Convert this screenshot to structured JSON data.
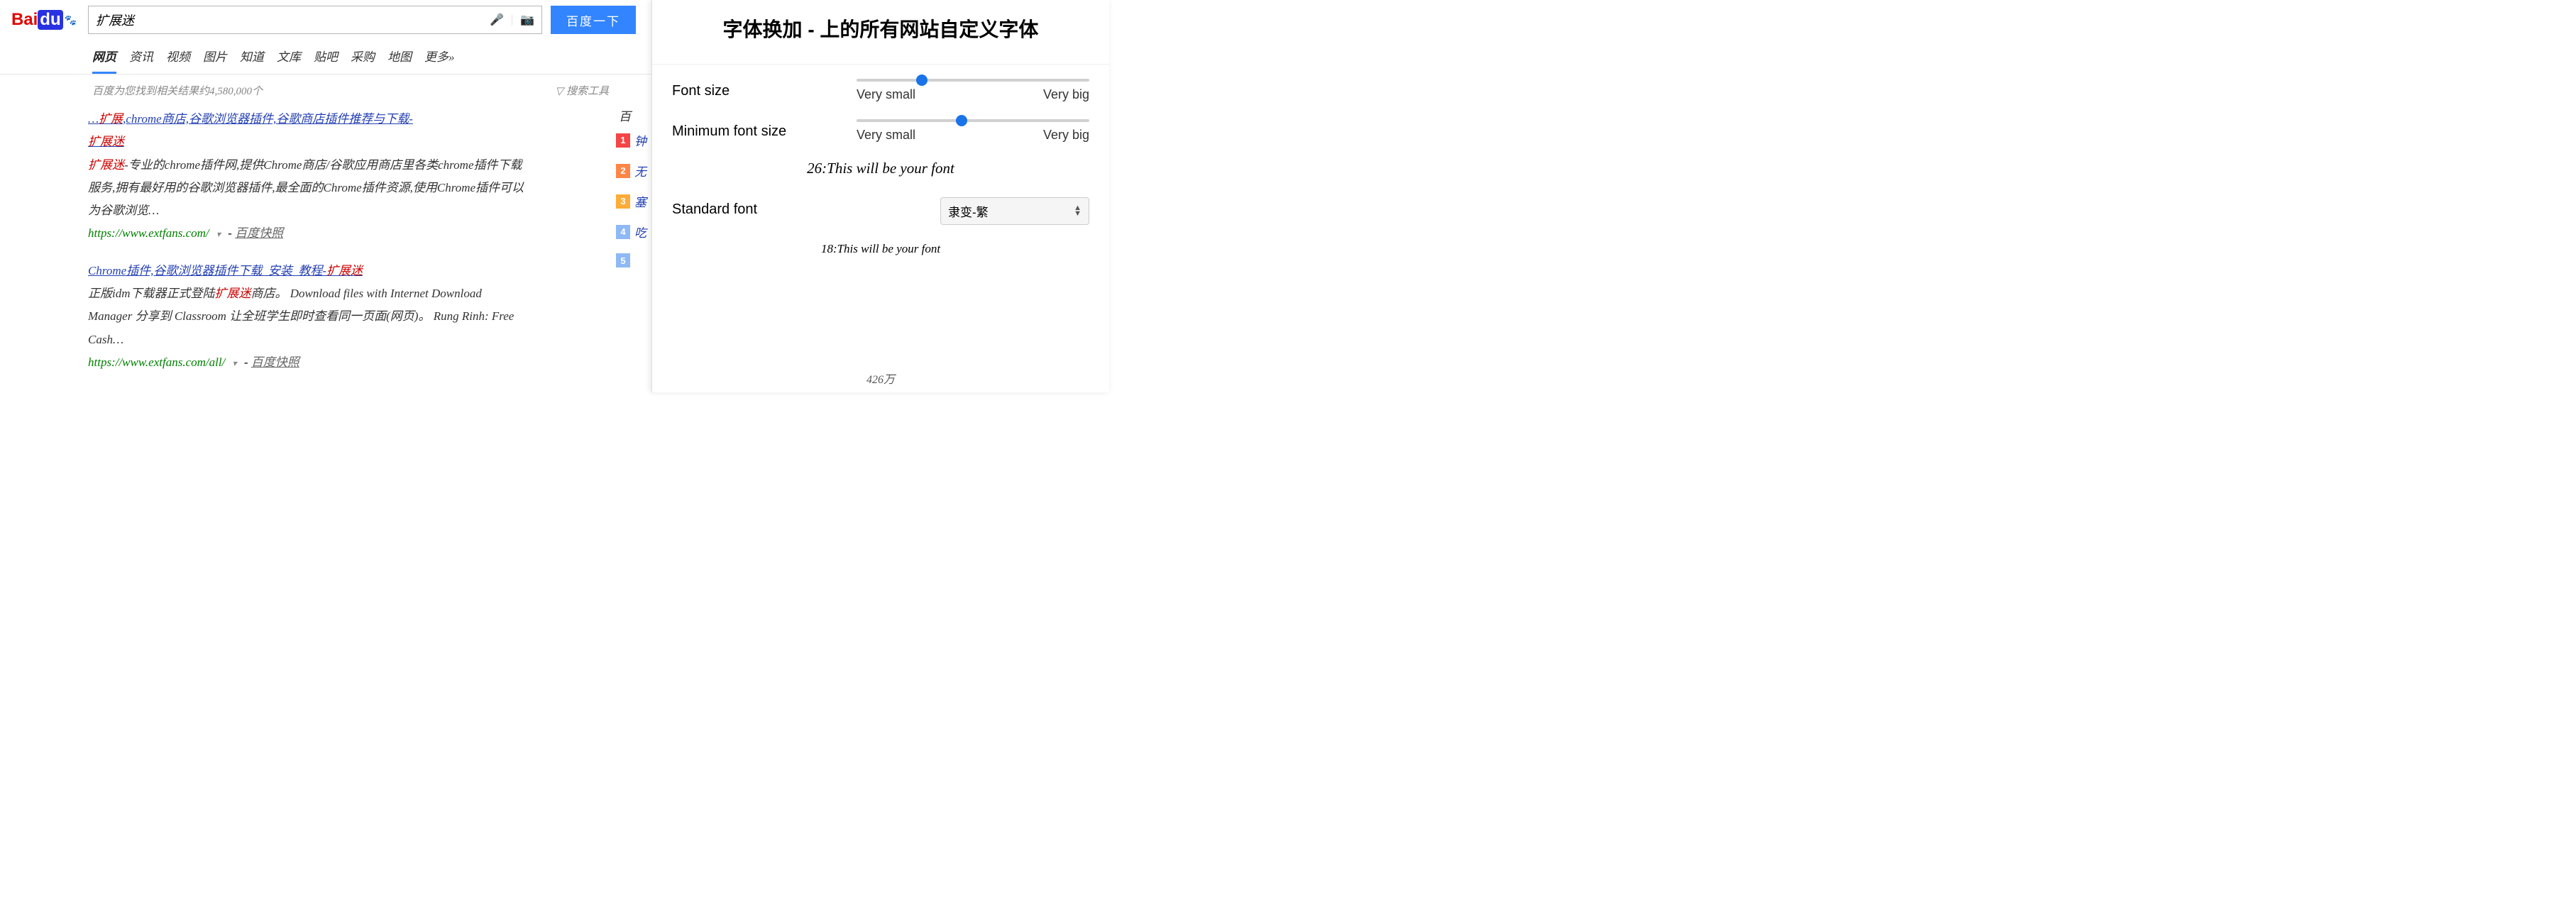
{
  "search": {
    "logo_bai": "Bai",
    "logo_du": "du",
    "query": "扩展迷",
    "button_label": "百度一下"
  },
  "tabs": [
    "网页",
    "资讯",
    "视频",
    "图片",
    "知道",
    "文库",
    "贴吧",
    "采购",
    "地图",
    "更多»"
  ],
  "active_tab_index": 0,
  "result_count_text": "百度为您找到相关结果约4,580,000个",
  "filter_label": "搜索工具",
  "results": [
    {
      "title_prefix": "…",
      "title_hl1": "扩展",
      "title_mid": ",chrome商店,谷歌浏览器插件,谷歌商店插件推荐与下载-",
      "title_hl2": "扩展迷",
      "snippet_hl": "扩展迷",
      "snippet_rest": "-专业的chrome插件网,提供Chrome商店/谷歌应用商店里各类chrome插件下载服务,拥有最好用的谷歌浏览器插件,最全面的Chrome插件资源,使用Chrome插件可以为谷歌浏览…",
      "url": "https://www.extfans.com/",
      "cache": "百度快照"
    },
    {
      "title_pre": "Chrome插件,谷歌浏览器插件下载_安装_教程-",
      "title_hl": "扩展迷",
      "snippet_pre": "正版idm下载器正式登陆",
      "snippet_hl": "扩展迷",
      "snippet_rest": "商店。 Download files with Internet Download Manager 分享到 Classroom 让全班学生即时查看同一页面(网页)。 Rung Rinh: Free Cash…",
      "url": "https://www.extfans.com/all/",
      "cache": "百度快照"
    }
  ],
  "hotlist": {
    "header": "百",
    "items": [
      {
        "num": "1",
        "text": "钟"
      },
      {
        "num": "2",
        "text": "无"
      },
      {
        "num": "3",
        "text": "塞"
      },
      {
        "num": "4",
        "text": "吃"
      },
      {
        "num": "5",
        "text": "",
        "count": "426万"
      }
    ]
  },
  "popup": {
    "title": "字体换加 - 上的所有网站自定义字体",
    "font_size_label": "Font size",
    "min_font_size_label": "Minimum font size",
    "very_small": "Very small",
    "very_big": "Very big",
    "slider1_percent": 28,
    "slider2_percent": 45,
    "preview1": "26:This will be your font",
    "standard_font_label": "Standard font",
    "standard_font_value": "隶变-繁",
    "preview2": "18:This will be your font"
  }
}
